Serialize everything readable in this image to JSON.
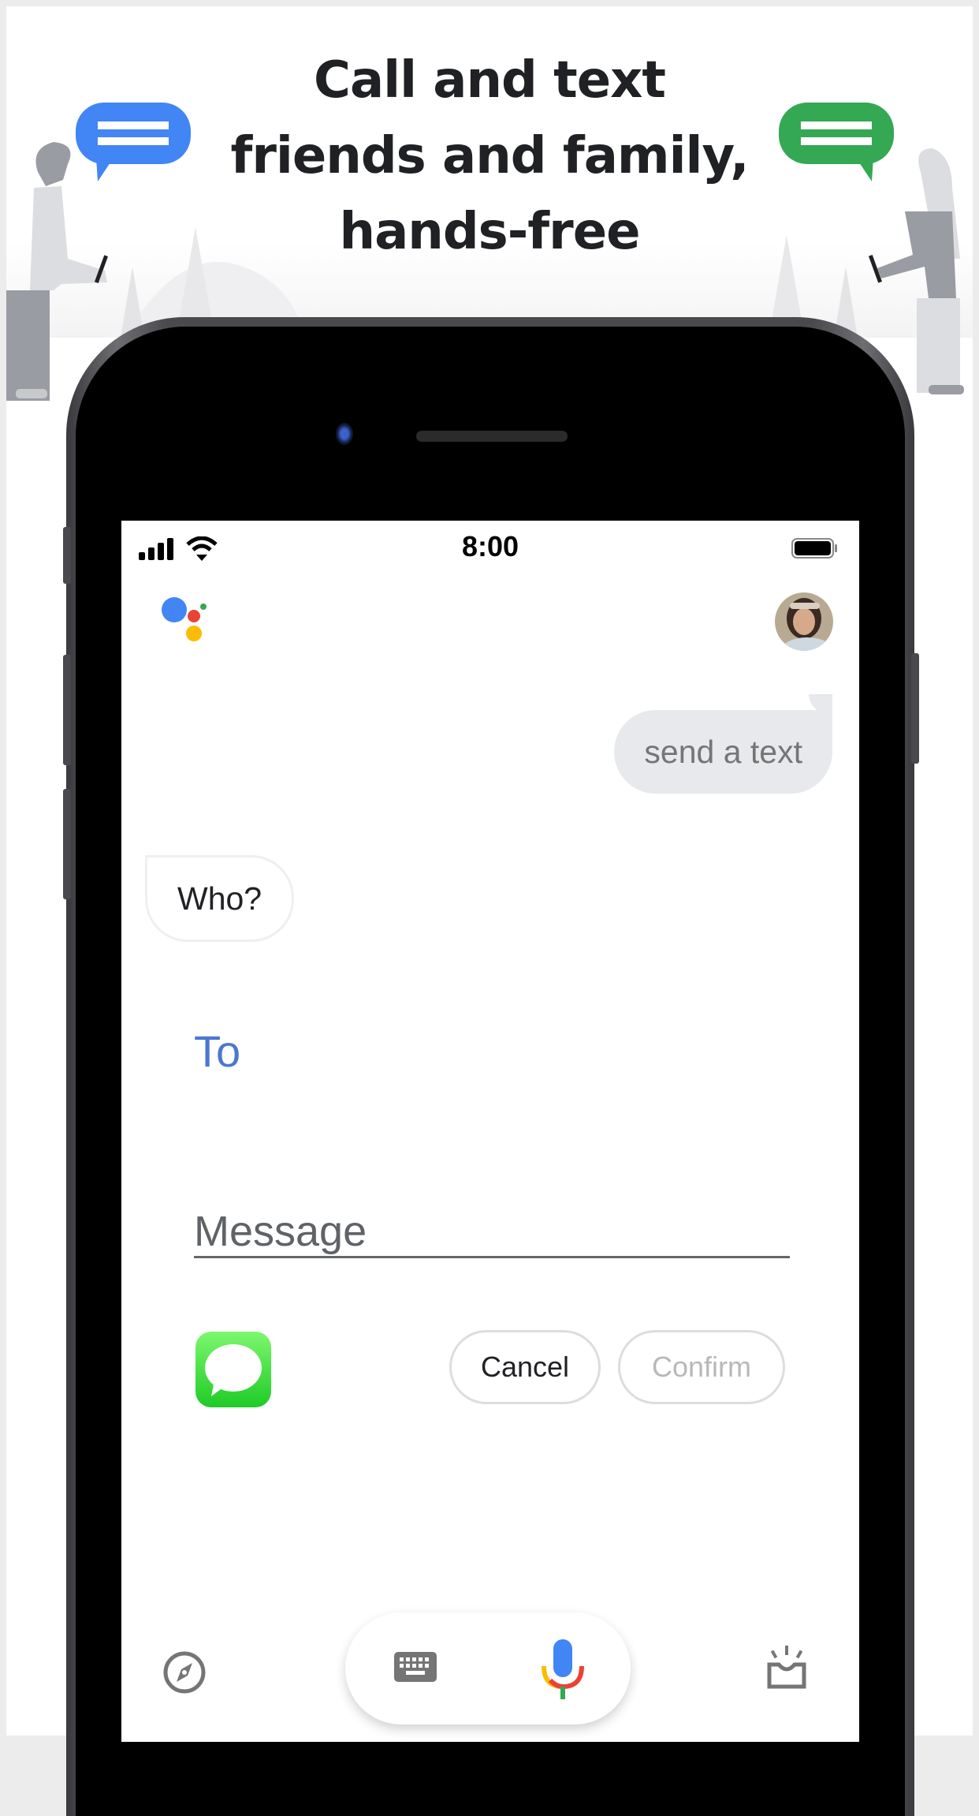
{
  "headline": {
    "lines": [
      "Call and text",
      "friends and family,",
      "hands-free"
    ]
  },
  "illustration": {
    "left_bubble_color": "#4285f4",
    "right_bubble_color": "#34a853"
  },
  "status_bar": {
    "time": "8:00",
    "signal_icon": "cellular-signal-icon",
    "wifi_icon": "wifi-icon",
    "battery_icon": "battery-icon"
  },
  "assistant": {
    "logo_icon": "google-assistant-logo-icon",
    "logo_colors": [
      "#4285f4",
      "#ea4335",
      "#fbbc05",
      "#34a853"
    ],
    "avatar": "user-avatar"
  },
  "conversation": {
    "user_message": "send a text",
    "assistant_reply": "Who?"
  },
  "compose": {
    "to_label": "To",
    "message_placeholder": "Message",
    "message_value": "",
    "app_icon": "messages-app-icon",
    "cancel_label": "Cancel",
    "confirm_label": "Confirm",
    "accent_color": "#4a78d0"
  },
  "bottom_bar": {
    "explore_icon": "compass-icon",
    "keyboard_icon": "keyboard-icon",
    "mic_icon": "microphone-icon",
    "updates_icon": "inbox-updates-icon"
  }
}
